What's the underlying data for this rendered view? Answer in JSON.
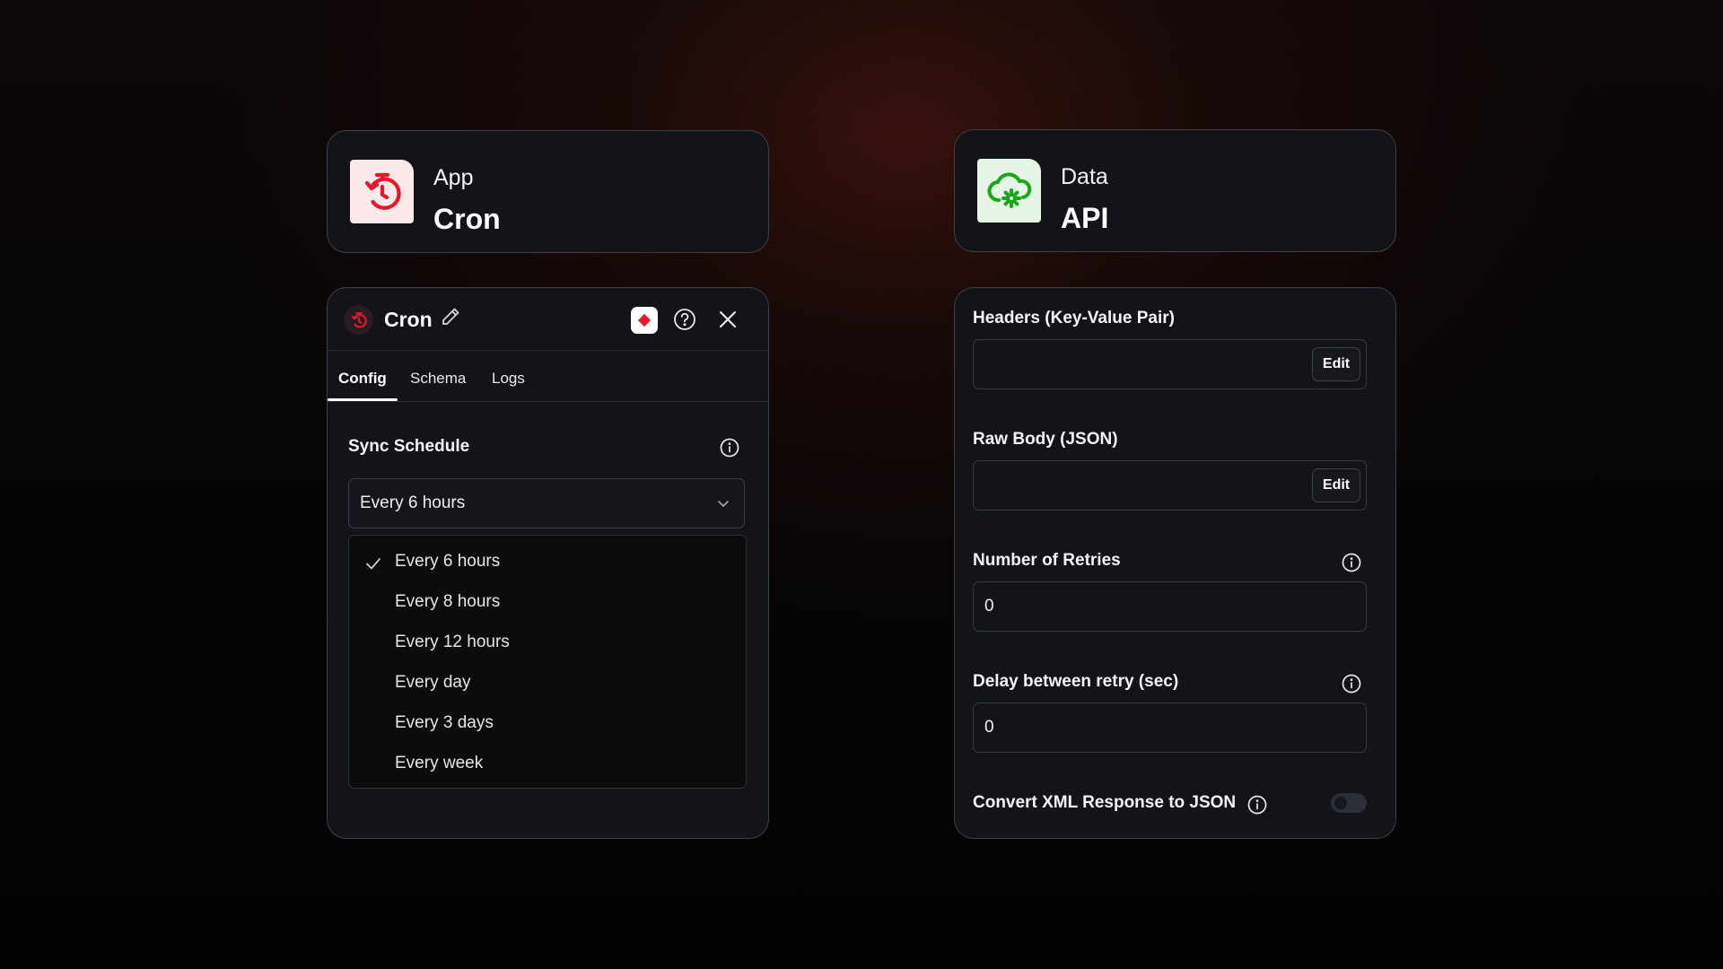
{
  "app_node": {
    "kind": "App",
    "name": "Cron",
    "icon": "timer-reset-icon",
    "color": "#e8182b"
  },
  "data_node": {
    "kind": "Data",
    "name": "API",
    "icon": "cloud-gear-icon",
    "color": "#1aa61a"
  },
  "cron_panel": {
    "title": "Cron",
    "tabs": [
      {
        "label": "Config",
        "active": true
      },
      {
        "label": "Schema",
        "active": false
      },
      {
        "label": "Logs",
        "active": false
      }
    ],
    "sync_schedule": {
      "label": "Sync Schedule",
      "selected": "Every 6 hours",
      "options": [
        {
          "label": "Every 6 hours",
          "selected": true
        },
        {
          "label": "Every 8 hours",
          "selected": false
        },
        {
          "label": "Every 12 hours",
          "selected": false
        },
        {
          "label": "Every day",
          "selected": false
        },
        {
          "label": "Every 3 days",
          "selected": false
        },
        {
          "label": "Every week",
          "selected": false
        }
      ]
    }
  },
  "api_panel": {
    "headers": {
      "label": "Headers (Key-Value Pair)",
      "button": "Edit"
    },
    "raw_body": {
      "label": "Raw Body (JSON)",
      "button": "Edit"
    },
    "retries": {
      "label": "Number of Retries",
      "value": "0"
    },
    "delay": {
      "label": "Delay between retry (sec)",
      "value": "0"
    },
    "convert_xml": {
      "label": "Convert XML Response to JSON",
      "enabled": false
    }
  }
}
